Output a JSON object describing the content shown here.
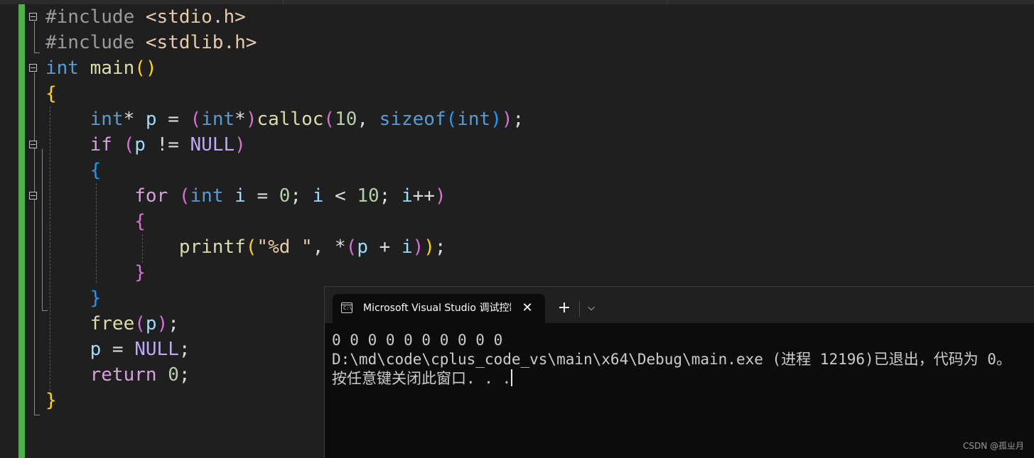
{
  "editor": {
    "code_lines": [
      [
        {
          "c": "t-pp",
          "t": "#include "
        },
        {
          "c": "t-str",
          "t": "<stdio.h>"
        }
      ],
      [
        {
          "c": "t-pp",
          "t": "#include "
        },
        {
          "c": "t-str",
          "t": "<stdlib.h>"
        }
      ],
      [
        {
          "c": "t-kw",
          "t": "int"
        },
        {
          "c": "t-op",
          "t": " "
        },
        {
          "c": "t-fn",
          "t": "main"
        },
        {
          "c": "t-p1",
          "t": "()"
        }
      ],
      [
        {
          "c": "t-p1",
          "t": "{"
        }
      ],
      [
        {
          "c": "t-op",
          "t": "    "
        },
        {
          "c": "t-kw",
          "t": "int"
        },
        {
          "c": "t-op",
          "t": "* "
        },
        {
          "c": "t-var",
          "t": "p"
        },
        {
          "c": "t-op",
          "t": " = "
        },
        {
          "c": "t-p2",
          "t": "("
        },
        {
          "c": "t-kw",
          "t": "int"
        },
        {
          "c": "t-op",
          "t": "*"
        },
        {
          "c": "t-p2",
          "t": ")"
        },
        {
          "c": "t-fn",
          "t": "calloc"
        },
        {
          "c": "t-p2",
          "t": "("
        },
        {
          "c": "t-num",
          "t": "10"
        },
        {
          "c": "t-op",
          "t": ", "
        },
        {
          "c": "t-kw",
          "t": "sizeof"
        },
        {
          "c": "t-p3",
          "t": "("
        },
        {
          "c": "t-kw",
          "t": "int"
        },
        {
          "c": "t-p3",
          "t": ")"
        },
        {
          "c": "t-p2",
          "t": ")"
        },
        {
          "c": "t-op",
          "t": ";"
        }
      ],
      [
        {
          "c": "t-op",
          "t": "    "
        },
        {
          "c": "t-ctl",
          "t": "if"
        },
        {
          "c": "t-op",
          "t": " "
        },
        {
          "c": "t-p2",
          "t": "("
        },
        {
          "c": "t-var",
          "t": "p"
        },
        {
          "c": "t-op",
          "t": " != "
        },
        {
          "c": "t-mac",
          "t": "NULL"
        },
        {
          "c": "t-p2",
          "t": ")"
        }
      ],
      [
        {
          "c": "t-op",
          "t": "    "
        },
        {
          "c": "t-p3",
          "t": "{"
        }
      ],
      [
        {
          "c": "t-op",
          "t": "        "
        },
        {
          "c": "t-ctl",
          "t": "for"
        },
        {
          "c": "t-op",
          "t": " "
        },
        {
          "c": "t-p2",
          "t": "("
        },
        {
          "c": "t-kw",
          "t": "int"
        },
        {
          "c": "t-op",
          "t": " "
        },
        {
          "c": "t-var",
          "t": "i"
        },
        {
          "c": "t-op",
          "t": " = "
        },
        {
          "c": "t-num",
          "t": "0"
        },
        {
          "c": "t-op",
          "t": "; "
        },
        {
          "c": "t-var",
          "t": "i"
        },
        {
          "c": "t-op",
          "t": " < "
        },
        {
          "c": "t-num",
          "t": "10"
        },
        {
          "c": "t-op",
          "t": "; "
        },
        {
          "c": "t-var",
          "t": "i"
        },
        {
          "c": "t-op",
          "t": "++"
        },
        {
          "c": "t-p2",
          "t": ")"
        }
      ],
      [
        {
          "c": "t-op",
          "t": "        "
        },
        {
          "c": "t-p2",
          "t": "{"
        }
      ],
      [
        {
          "c": "t-op",
          "t": "            "
        },
        {
          "c": "t-fn",
          "t": "printf"
        },
        {
          "c": "t-p1",
          "t": "("
        },
        {
          "c": "t-str",
          "t": "\"%d \""
        },
        {
          "c": "t-op",
          "t": ", *"
        },
        {
          "c": "t-p2",
          "t": "("
        },
        {
          "c": "t-var",
          "t": "p"
        },
        {
          "c": "t-op",
          "t": " + "
        },
        {
          "c": "t-var",
          "t": "i"
        },
        {
          "c": "t-p2",
          "t": ")"
        },
        {
          "c": "t-p1",
          "t": ")"
        },
        {
          "c": "t-op",
          "t": ";"
        }
      ],
      [
        {
          "c": "t-op",
          "t": "        "
        },
        {
          "c": "t-p2",
          "t": "}"
        }
      ],
      [
        {
          "c": "t-op",
          "t": "    "
        },
        {
          "c": "t-p3",
          "t": "}"
        }
      ],
      [
        {
          "c": "t-op",
          "t": "    "
        },
        {
          "c": "t-fn",
          "t": "free"
        },
        {
          "c": "t-p2",
          "t": "("
        },
        {
          "c": "t-var",
          "t": "p"
        },
        {
          "c": "t-p2",
          "t": ")"
        },
        {
          "c": "t-op",
          "t": ";"
        }
      ],
      [
        {
          "c": "t-op",
          "t": "    "
        },
        {
          "c": "t-var",
          "t": "p"
        },
        {
          "c": "t-op",
          "t": " = "
        },
        {
          "c": "t-mac",
          "t": "NULL"
        },
        {
          "c": "t-op",
          "t": ";"
        }
      ],
      [
        {
          "c": "t-op",
          "t": "    "
        },
        {
          "c": "t-ctl",
          "t": "return"
        },
        {
          "c": "t-op",
          "t": " "
        },
        {
          "c": "t-num",
          "t": "0"
        },
        {
          "c": "t-op",
          "t": ";"
        }
      ],
      [
        {
          "c": "t-p1",
          "t": "}"
        }
      ]
    ]
  },
  "console": {
    "tab_title": "Microsoft Visual Studio 调试控制台",
    "tab_icon": "terminal-icon",
    "tab_icon_text": "C:\\",
    "close_glyph": "✕",
    "new_tab_glyph": "+",
    "dropdown_glyph": "⌵",
    "output": {
      "line1": "0 0 0 0 0 0 0 0 0 0",
      "line2": "D:\\md\\code\\cplus_code_vs\\main\\x64\\Debug\\main.exe (进程 12196)已退出，代码为 0。",
      "line3": "按任意键关闭此窗口. . ."
    }
  },
  "watermark": "CSDN @孤ㄓ月"
}
